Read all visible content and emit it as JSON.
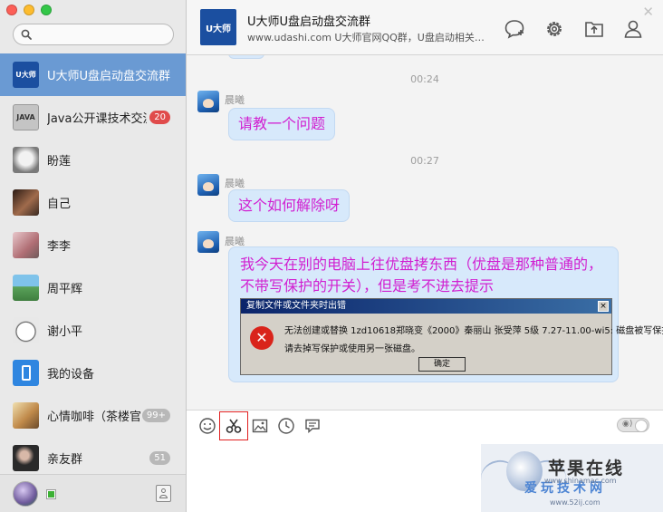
{
  "sidebar": {
    "search": {
      "placeholder": "",
      "value": ""
    },
    "contacts": [
      {
        "name": "U大师U盘启动盘交流群",
        "avatar_text": "U大师",
        "avatar_color": "#1b4fa0",
        "badge": "",
        "active": true
      },
      {
        "name": "Java公开课技术交流",
        "avatar_text": "JAVA",
        "avatar_color": "#b9b9b9",
        "badge": "20",
        "badge_color": "red"
      },
      {
        "name": "盼莲",
        "avatar_text": "",
        "avatar_color": "#9a9a9a",
        "badge": ""
      },
      {
        "name": "自己",
        "avatar_text": "",
        "avatar_color": "#5a3a2a",
        "badge": ""
      },
      {
        "name": "李李",
        "avatar_text": "",
        "avatar_color": "#c98a8e",
        "badge": ""
      },
      {
        "name": "周平辉",
        "avatar_text": "",
        "avatar_color": "#7bb86f",
        "badge": ""
      },
      {
        "name": "谢小平",
        "avatar_text": "",
        "avatar_color": "#e6e6e6",
        "badge": ""
      },
      {
        "name": "我的设备",
        "avatar_text": "",
        "avatar_color": "#2f86e0",
        "badge": ""
      },
      {
        "name": "心情咖啡（茶楼官",
        "avatar_text": "",
        "avatar_color": "#c8a86a",
        "badge": "99+",
        "badge_color": "gray"
      },
      {
        "name": "亲友群",
        "avatar_text": "",
        "avatar_color": "#3a3a3a",
        "badge": "51",
        "badge_color": "gray"
      }
    ],
    "footer": {
      "status_color": "#3cb034"
    }
  },
  "header": {
    "logo_text": "U大师",
    "title": "U大师U盘启动盘交流群",
    "subtitle": "www.udashi.com  U大师官网QQ群，U盘启动相关…",
    "icons": [
      "chat-bubble-icon",
      "gear-icon",
      "upload-icon",
      "person-icon"
    ]
  },
  "messages": [
    {
      "time": "00:24",
      "sender": "晨曦",
      "text": "请教一个问题"
    },
    {
      "time": "00:27",
      "sender": "晨曦",
      "text": "这个如何解除呀"
    },
    {
      "time": "",
      "sender": "晨曦",
      "text": "我今天在别的电脑上往优盘拷东西（优盘是那种普通的，不带写保护的开关），但是考不进去提示",
      "screenshot": {
        "title": "复制文件或文件夹时出错",
        "line1": "无法创建或替换 1zd10618郑晓变《2000》秦丽山 张受萍 5级 7.27-11.00-wi5: 磁盘被写保护。",
        "line2": "请去掉写保护或使用另一张磁盘。",
        "button": "确定"
      }
    }
  ],
  "composer": {
    "tools": [
      "emoji-icon",
      "scissors-icon",
      "image-icon",
      "clock-icon",
      "history-icon"
    ],
    "selected_tool": "scissors-icon",
    "input_value": ""
  },
  "watermark": {
    "title": "苹果在线",
    "subtitle": "爱玩技术网",
    "url1": "www.shinamac.com",
    "url2": "www.52ij.com"
  },
  "colors": {
    "accent": "#6a9ad3",
    "message_text": "#d11fd1",
    "bubble": "#d7e9fb"
  }
}
